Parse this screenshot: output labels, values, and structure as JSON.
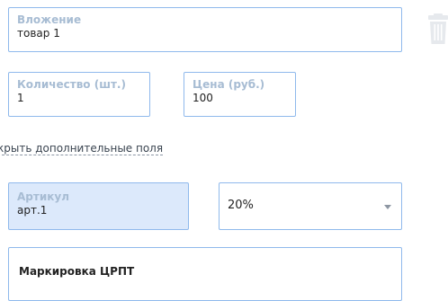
{
  "fields": {
    "attachment": {
      "label": "Вложение",
      "value": "товар 1"
    },
    "quantity": {
      "label": "Количество (шт.)",
      "value": "1"
    },
    "price": {
      "label": "Цена (руб.)",
      "value": "100"
    },
    "sku": {
      "label": "Артикул",
      "value": "арт.1"
    }
  },
  "vat": {
    "selected": "20%"
  },
  "toggle_link": "крыть дополнительные поля",
  "marking": {
    "title": "Маркировка ЦРПТ"
  },
  "icons": {
    "delete": "trash-icon",
    "dropdown": "chevron-down-icon"
  },
  "colors": {
    "border": "#8fb9ec",
    "label": "#a7bcd3",
    "sku_bg": "#dce9fb",
    "icon": "#e6e9ed"
  }
}
